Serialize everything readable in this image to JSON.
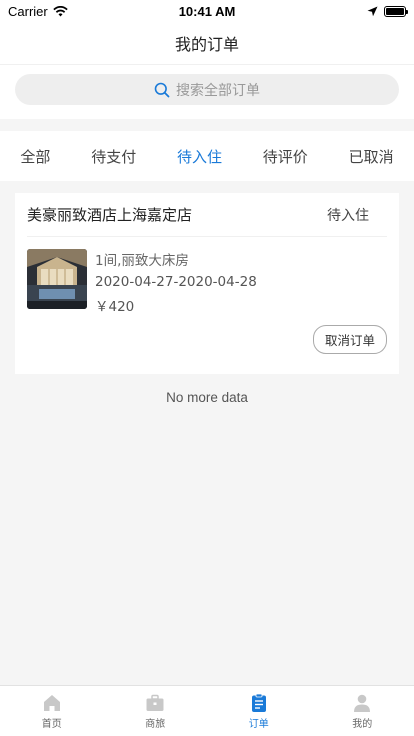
{
  "status_bar": {
    "carrier": "Carrier",
    "time": "10:41 AM"
  },
  "nav": {
    "title": "我的订单"
  },
  "search": {
    "placeholder": "搜索全部订单"
  },
  "tabs": [
    {
      "label": "全部"
    },
    {
      "label": "待支付"
    },
    {
      "label": "待入住",
      "active": true
    },
    {
      "label": "待评价"
    },
    {
      "label": "已取消"
    }
  ],
  "order": {
    "hotel_name": "美豪丽致酒店上海嘉定店",
    "status": "待入住",
    "room": "1间,丽致大床房",
    "dates": "2020-04-27-2020-04-28",
    "price": "￥420",
    "cancel_label": "取消订单"
  },
  "list_footer": "No more data",
  "tab_bar": [
    {
      "label": "首页",
      "icon": "home-icon"
    },
    {
      "label": "商旅",
      "icon": "briefcase-icon"
    },
    {
      "label": "订单",
      "icon": "clipboard-icon",
      "active": true
    },
    {
      "label": "我的",
      "icon": "user-icon"
    }
  ],
  "colors": {
    "accent": "#1a7ad8",
    "background": "#f5f5f5"
  }
}
